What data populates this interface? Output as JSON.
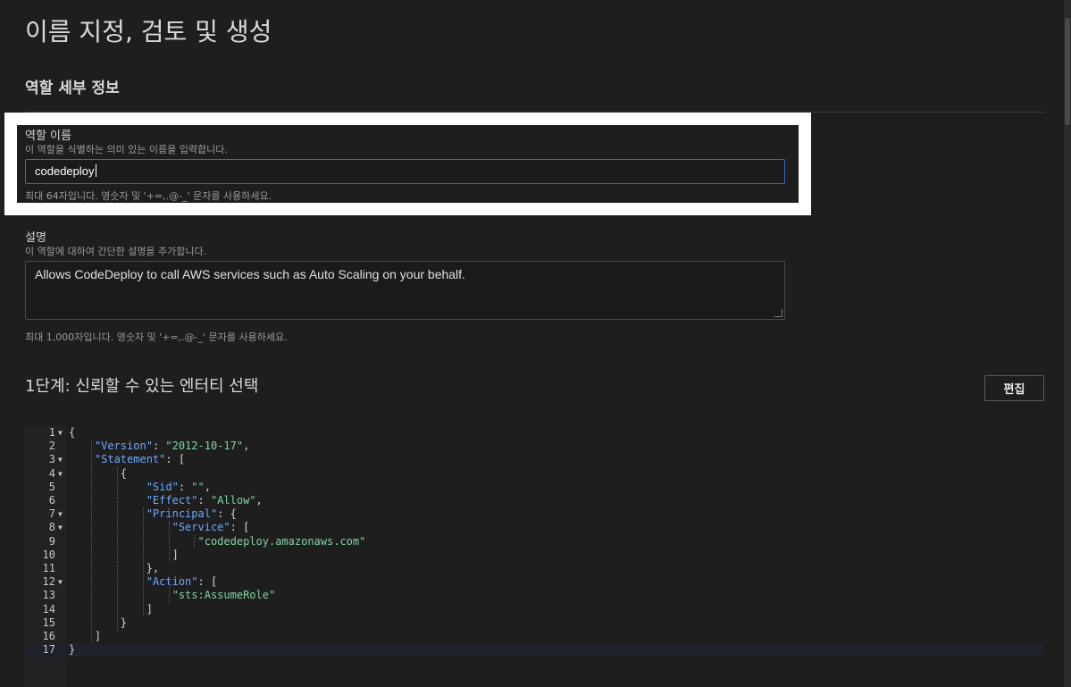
{
  "page": {
    "title": "이름 지정, 검토 및 생성",
    "section_title": "역할 세부 정보"
  },
  "role_name": {
    "label": "역할 이름",
    "help": "이 역할을 식별하는 의미 있는 이름을 입력합니다.",
    "value": "codedeploy",
    "constraint": "최대 64자입니다. 영숫자 및 '+=,.@-_' 문자를 사용하세요."
  },
  "description": {
    "label": "설명",
    "help": "이 역할에 대하여 간단한 설명을 추가합니다.",
    "value": "Allows CodeDeploy to call AWS services such as Auto Scaling on your behalf.",
    "constraint": "최대 1,000자입니다. 영숫자 및 '+=,.@-_' 문자를 사용하세요."
  },
  "step1": {
    "title": "1단계: 신뢰할 수 있는 엔터티 선택",
    "edit_label": "편집"
  },
  "policy_editor": {
    "lines": [
      {
        "n": "1",
        "fold": true,
        "code": "{"
      },
      {
        "n": "2",
        "fold": false,
        "code": "    \"Version\": \"2012-10-17\","
      },
      {
        "n": "3",
        "fold": true,
        "code": "    \"Statement\": ["
      },
      {
        "n": "4",
        "fold": true,
        "code": "        {"
      },
      {
        "n": "5",
        "fold": false,
        "code": "            \"Sid\": \"\","
      },
      {
        "n": "6",
        "fold": false,
        "code": "            \"Effect\": \"Allow\","
      },
      {
        "n": "7",
        "fold": true,
        "code": "            \"Principal\": {"
      },
      {
        "n": "8",
        "fold": true,
        "code": "                \"Service\": ["
      },
      {
        "n": "9",
        "fold": false,
        "code": "                    \"codedeploy.amazonaws.com\""
      },
      {
        "n": "10",
        "fold": false,
        "code": "                ]"
      },
      {
        "n": "11",
        "fold": false,
        "code": "            },"
      },
      {
        "n": "12",
        "fold": true,
        "code": "            \"Action\": ["
      },
      {
        "n": "13",
        "fold": false,
        "code": "                \"sts:AssumeRole\""
      },
      {
        "n": "14",
        "fold": false,
        "code": "            ]"
      },
      {
        "n": "15",
        "fold": false,
        "code": "        }"
      },
      {
        "n": "16",
        "fold": false,
        "code": "    ]"
      },
      {
        "n": "17",
        "fold": false,
        "code": "}"
      }
    ]
  },
  "colors": {
    "background": "#1e1e1e",
    "focus_border": "#2a6bd6",
    "json_key": "#6fa8ff",
    "json_string": "#7fd3a3",
    "highlight_frame": "#ffffff"
  }
}
